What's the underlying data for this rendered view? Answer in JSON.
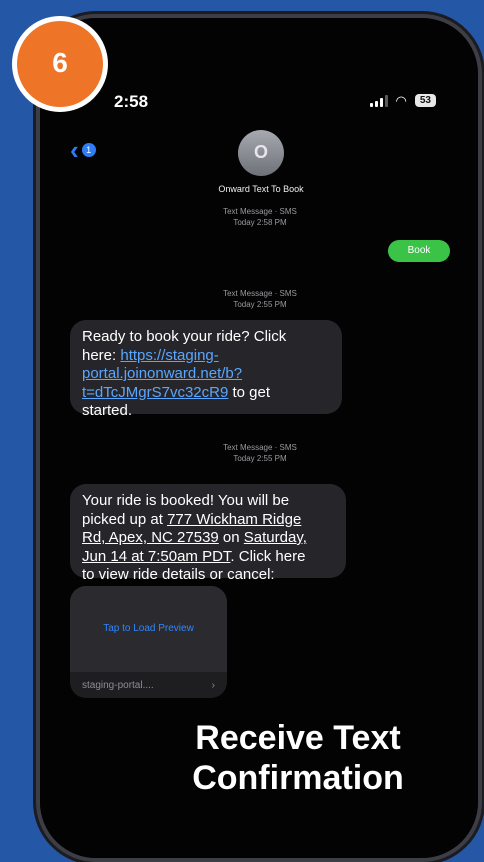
{
  "step": {
    "number": "6"
  },
  "status": {
    "time": "2:58",
    "battery": "53"
  },
  "header": {
    "back_badge": "1",
    "avatar_glyph": "O",
    "contact_name": "Onward Text To Book"
  },
  "thread": {
    "timestamps": [
      {
        "line1": "Text Message · SMS",
        "line2": "Today 2:58 PM"
      },
      {
        "line1": "Text Message · SMS",
        "line2": "Today 2:55 PM"
      },
      {
        "line1": "Text Message · SMS",
        "line2": "Today 2:55 PM"
      }
    ],
    "sent": {
      "text": "Book"
    },
    "msg1": {
      "line1": "Ready to book your ride? Click",
      "line2": "here: ",
      "link1": "https://staging-",
      "link2": "portal.joinonward.net/b?",
      "link3": "t=dTcJMgrS7vc32cR9",
      "line4_end": " to get",
      "line5": "started."
    },
    "msg2": {
      "line1": "Your ride is booked! You will be",
      "line2": "picked up at ",
      "addr1": "777 Wickham Ridge",
      "addr2": "Rd, Apex, NC 27539",
      "line3_mid": " on ",
      "date1": "Saturday,",
      "date2": "Jun 14 at 7:50am PDT",
      "line4_end": ". Click here",
      "line5": "to view ride details or cancel:"
    },
    "preview": {
      "load_label": "Tap to Load Preview",
      "domain": "staging-portal....",
      "chevron": "›"
    }
  },
  "caption": {
    "line1": "Receive Text",
    "line2": "Confirmation"
  },
  "colors": {
    "background": "#2557a7",
    "badge": "#ee7527",
    "sent_bubble": "#3bc348",
    "link": "#5aa6ff"
  }
}
